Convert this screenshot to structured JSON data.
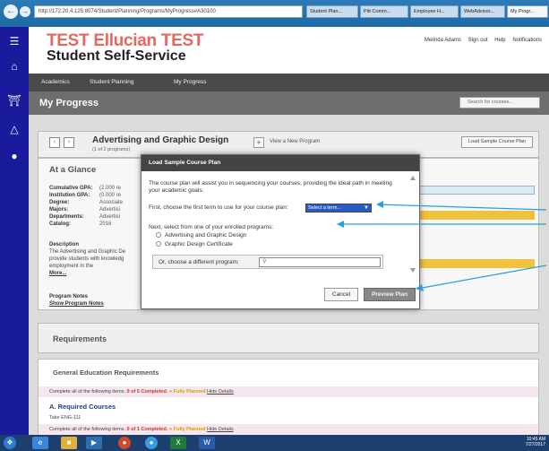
{
  "browser": {
    "url": "http://172.20.4.125:8074/Student/Planning/Programs/MyProgress#A30100",
    "tabs": [
      "Student Plan...",
      "Pitt Comm...",
      "Employee H...",
      "WebAdvisor...",
      "My Progr..."
    ],
    "back_icon": "back-arrow-icon",
    "forward_icon": "forward-arrow-icon"
  },
  "header": {
    "brand_line1": "TEST Ellucian TEST",
    "brand_line2": "Student Self-Service",
    "user": "Melinda Adams",
    "sign_out": "Sign out",
    "help": "Help",
    "notifications": "Notifications"
  },
  "menu": {
    "items": [
      "Academics",
      "Student Planning",
      "My Progress"
    ]
  },
  "page": {
    "title": "My Progress",
    "search_placeholder": "Search for courses..."
  },
  "program": {
    "title": "Advertising and Graphic Design",
    "subtitle": "(1 of 2 programs)",
    "view_new": "View a New Program",
    "load_sample": "Load Sample Course Plan"
  },
  "glance": {
    "title": "At a Glance",
    "rows": [
      {
        "label": "Cumulative GPA:",
        "value": "(2.000 re"
      },
      {
        "label": "Institution GPA:",
        "value": "(0.000 re"
      },
      {
        "label": "Degree:",
        "value": "Associate"
      },
      {
        "label": "Majors:",
        "value": "Advertisi"
      },
      {
        "label": "Departments:",
        "value": "Advertisi"
      },
      {
        "label": "Catalog:",
        "value": "2016"
      }
    ],
    "description_label": "Description",
    "description": [
      "The Advertising and Graphic De",
      "provide students with knowledg",
      "employment in the"
    ],
    "more": "More...",
    "notes_label": "Program Notes",
    "show_notes": "Show Program Notes"
  },
  "requirements": {
    "title": "Requirements",
    "gen_ed_title": "General Education Requirements",
    "complete_all_1": "Complete all of the following items.",
    "completed_1": "0 of 5 Completed.",
    "fully_planned": "Fully Planned",
    "hide_details": "Hide Details",
    "section_a": "A. Required Courses",
    "take": "Take ENG-111",
    "complete_all_2": "Complete all of the following items.",
    "completed_2": "0 of 1 Completed."
  },
  "modal": {
    "title": "Load Sample Course Plan",
    "intro": "The course plan will assist you in sequencing your courses, providing the ideal path in meeting your academic goals.",
    "first_choose": "First, choose the first term to use for your course plan:",
    "term_select_value": "Select a term...",
    "next_select": "Next, select from one of your enrolled programs:",
    "programs": [
      "Advertising and Graphic Design",
      "Graphic Design Certificate"
    ],
    "other_program_label": "Or, choose a different program:",
    "cancel": "Cancel",
    "preview": "Preview Plan"
  },
  "taskbar": {
    "time": "10:45 AM",
    "date": "7/27/2017"
  },
  "colors": {
    "brand_red": "#e8675c",
    "rail_blue": "#1a1a9c",
    "select_blue": "#2a5bc2",
    "annotation_blue": "#2a9fd8"
  }
}
